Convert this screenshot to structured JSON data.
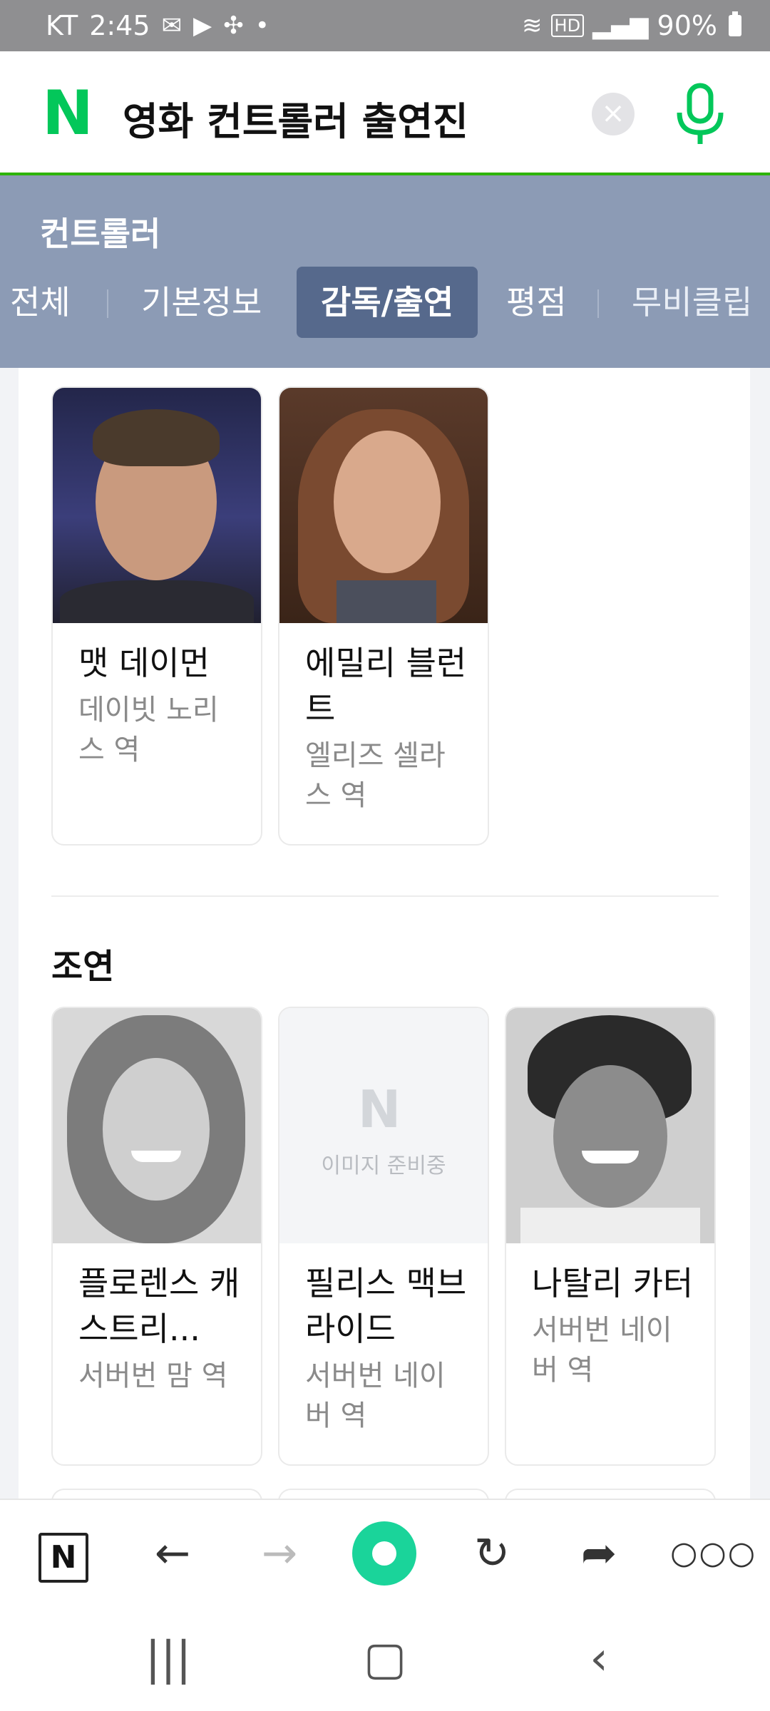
{
  "status_bar": {
    "carrier": "KT",
    "time": "2:45",
    "battery": "90%"
  },
  "search": {
    "query": "영화 컨트롤러 출연진"
  },
  "movie": {
    "title": "컨트롤러",
    "tabs": [
      {
        "label": "전체",
        "active": false
      },
      {
        "label": "기본정보",
        "active": false
      },
      {
        "label": "감독/출연",
        "active": true
      },
      {
        "label": "평점",
        "active": false
      },
      {
        "label": "무비클립",
        "active": false
      }
    ]
  },
  "lead_cast": [
    {
      "name": "맷 데이먼",
      "role": "데이빗 노리스 역"
    },
    {
      "name": "에밀리 블런트",
      "role": "엘리즈 셀라스 역"
    }
  ],
  "supporting": {
    "section_title": "조연",
    "placeholder_text": "이미지 준비중",
    "cast": [
      {
        "name": "플로렌스 캐스트리...",
        "role": "서버번 맘 역"
      },
      {
        "name": "필리스 맥브라이드",
        "role": "서버번 네이버 역"
      },
      {
        "name": "나탈리 카터",
        "role": "서버번 네이버 역"
      }
    ]
  },
  "colors": {
    "brand_green": "#03c75a",
    "nav_panel": "#8c9bb5",
    "active_tab": "#56698c"
  }
}
